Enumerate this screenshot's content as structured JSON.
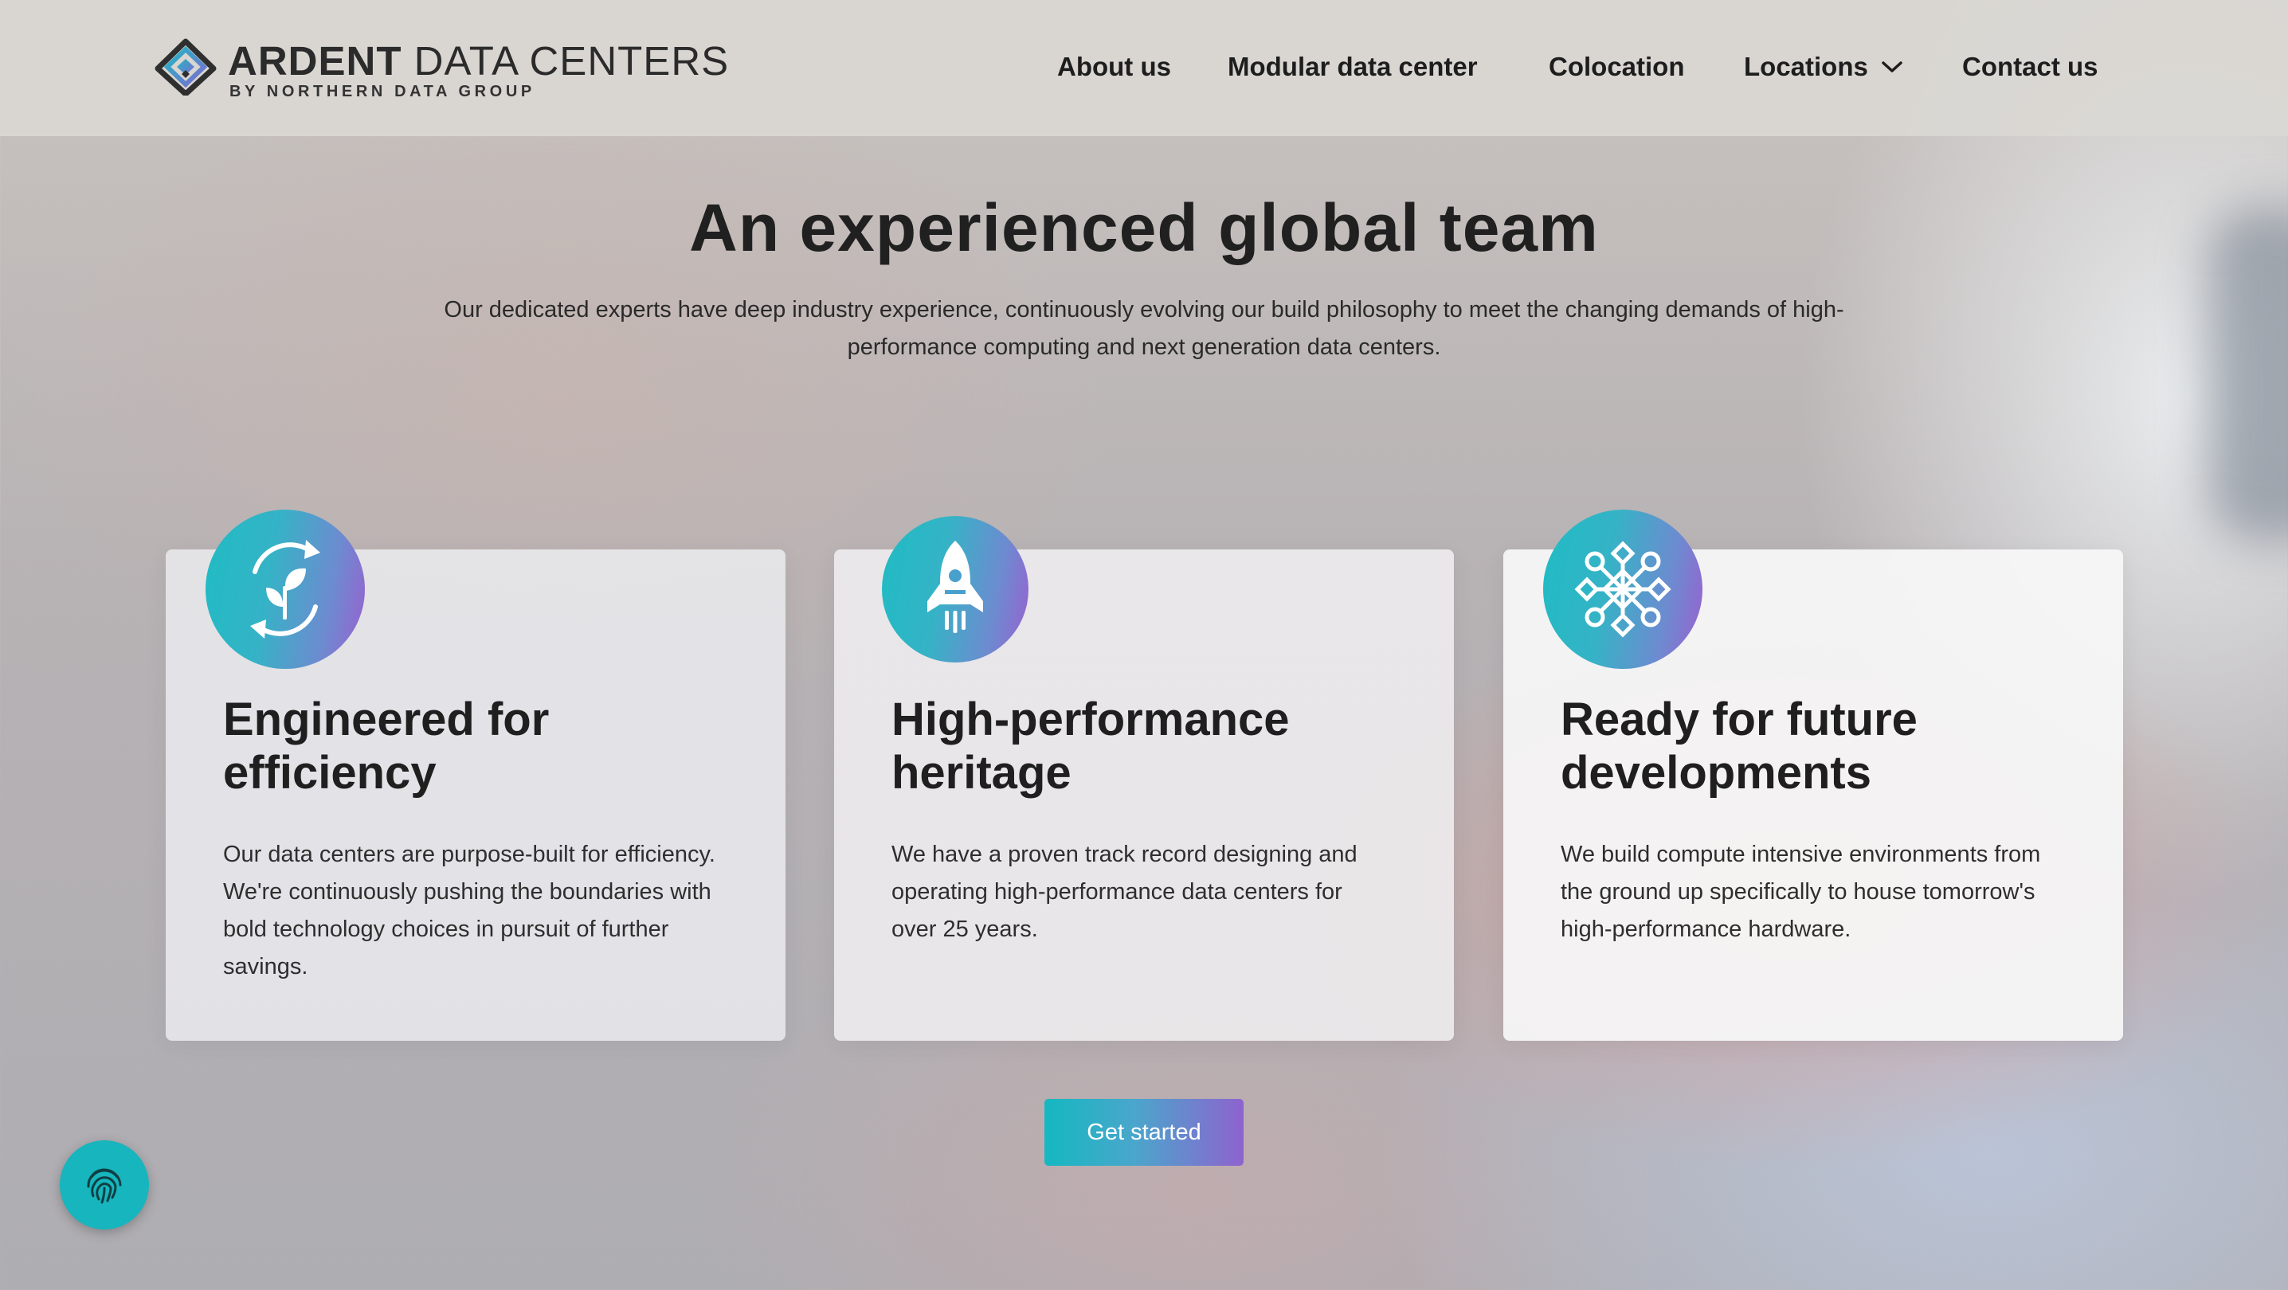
{
  "header": {
    "logo": {
      "title_bold": "ARDENT",
      "title_rest": " DATA CENTERS",
      "subtitle": "BY NORTHERN DATA GROUP"
    },
    "nav": [
      {
        "label": "About us"
      },
      {
        "label": "Modular data center"
      },
      {
        "label": "Colocation"
      },
      {
        "label": "Locations",
        "icon": "chevron-down-icon"
      },
      {
        "label": "Contact us"
      }
    ]
  },
  "hero": {
    "title": "An experienced global team",
    "description": "Our dedicated experts have deep industry experience, continuously evolving our build philosophy to meet the changing demands of high-performance computing and next generation data centers."
  },
  "cards": [
    {
      "icon": "leaf-recycle-icon",
      "title": "Engineered for efficiency",
      "text": "Our data centers are purpose-built for efficiency. We're continuously pushing the boundaries with bold technology choices in pursuit of further savings."
    },
    {
      "icon": "rocket-icon",
      "title": "High-performance heritage",
      "text": "We have a proven track record designing and operating high-performance data centers for over 25 years."
    },
    {
      "icon": "network-pattern-icon",
      "title": "Ready for future developments",
      "text": "We build compute intensive environments from the ground up specifically to house tomorrow's high-performance hardware."
    }
  ],
  "cta": {
    "label": "Get started"
  },
  "floating": {
    "icon": "fingerprint-icon"
  },
  "colors": {
    "accent_teal": "#14b8c0",
    "accent_purple": "#8e63cf",
    "text_dark": "#1f1f1f"
  }
}
